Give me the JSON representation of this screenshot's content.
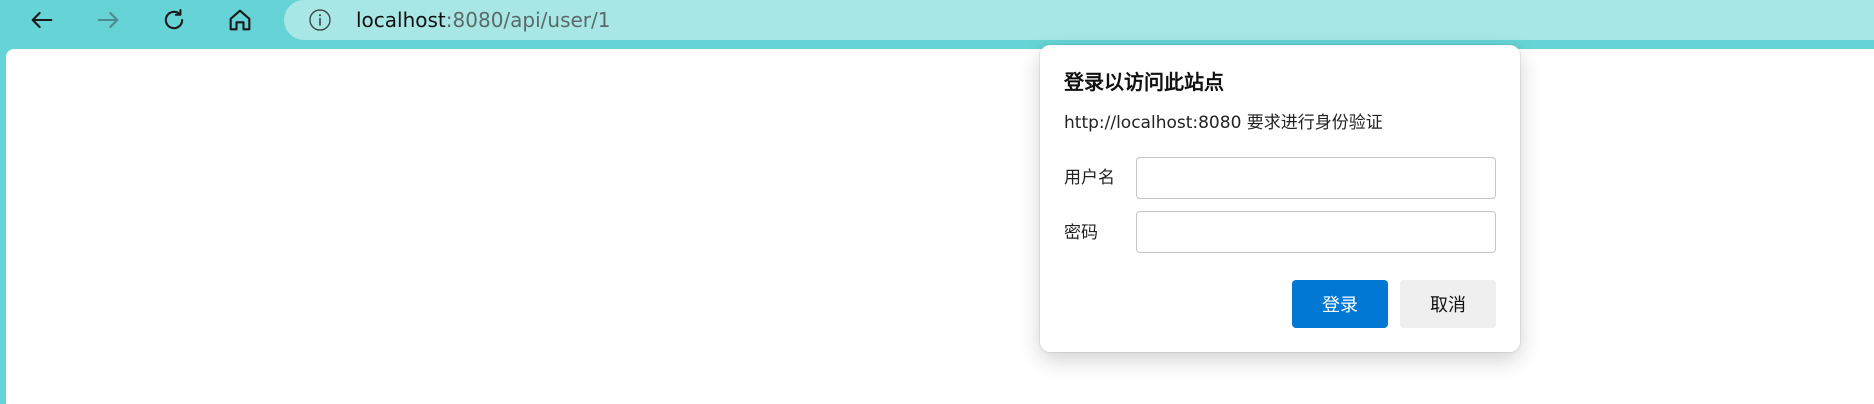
{
  "browser": {
    "address_bar": {
      "host": "localhost",
      "rest": ":8080/api/user/1"
    },
    "icons": {
      "back": "arrow-left-icon",
      "forward": "arrow-right-icon",
      "reload": "refresh-icon",
      "home": "home-icon",
      "site_info": "info-icon"
    }
  },
  "auth_dialog": {
    "title": "登录以访问此站点",
    "description": "http://localhost:8080 要求进行身份验证",
    "username_label": "用户名",
    "username_value": "",
    "password_label": "密码",
    "password_value": "",
    "login_button": "登录",
    "cancel_button": "取消"
  },
  "colors": {
    "browser_frame": "#66d4d6",
    "address_bar": "#a9e6e6",
    "primary_button": "#0078d4",
    "secondary_button": "#efefef"
  }
}
